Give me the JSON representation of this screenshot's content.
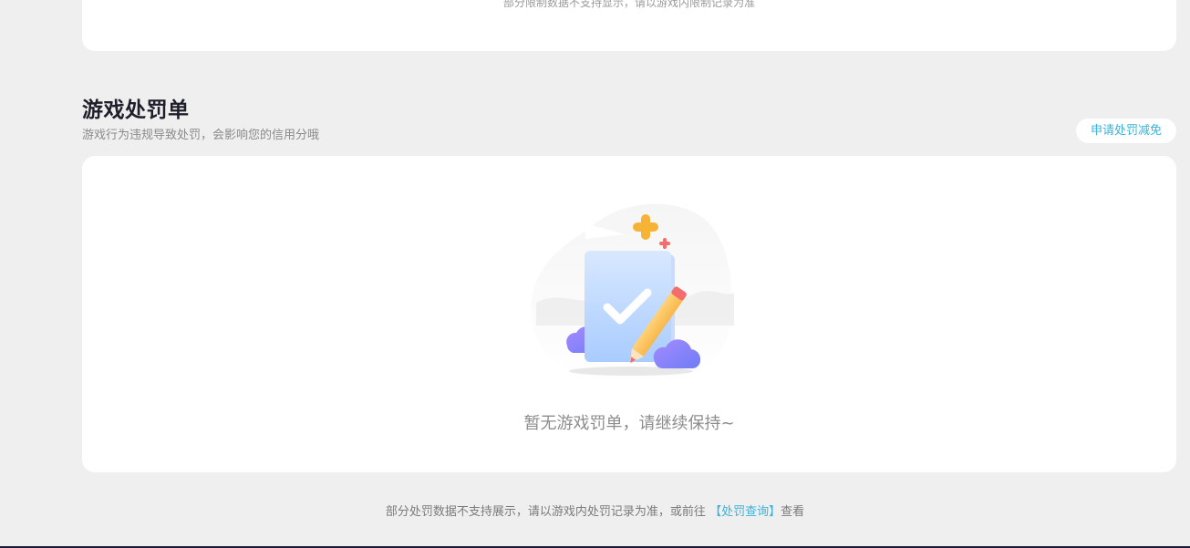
{
  "top_card": {
    "note": "部分限制数据不支持显示，请以游戏内限制记录为准"
  },
  "penalty_section": {
    "title": "游戏处罚单",
    "subtitle": "游戏行为违规导致处罚，会影响您的信用分哦",
    "appeal_button_label": "申请处罚减免",
    "empty_state_text": "暂无游戏罚单，请继续保持~",
    "illustration_icon": "empty-document-check-icon"
  },
  "footer": {
    "note_prefix": "部分处罚数据不支持展示，请以游戏内处罚记录为准，或前往",
    "link_label": "【处罚查询】",
    "note_suffix": "查看"
  },
  "colors": {
    "background": "#efefef",
    "card": "#ffffff",
    "accent": "#39b3d8",
    "title": "#1f1f2b",
    "muted_text": "#8a8a8a"
  }
}
